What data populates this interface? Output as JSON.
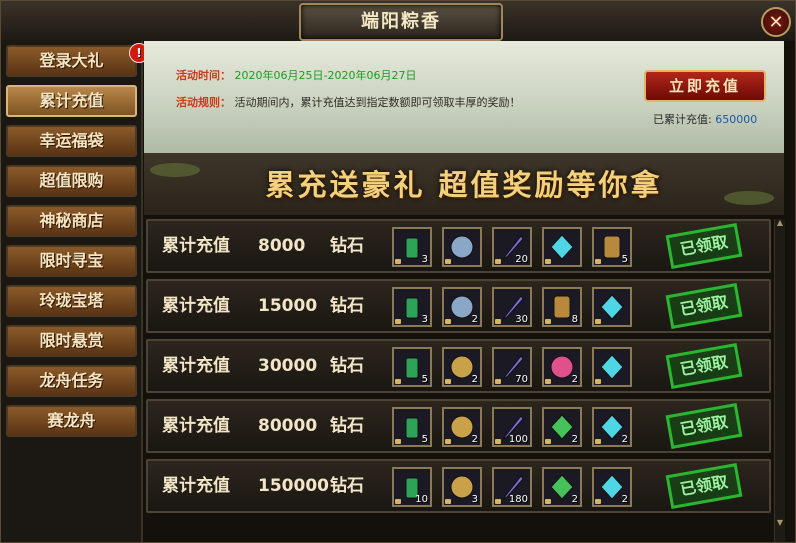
{
  "window": {
    "title": "端阳粽香",
    "close_glyph": "✕"
  },
  "sidebar": {
    "badge": "!",
    "items": [
      {
        "label": "登录大礼"
      },
      {
        "label": "累计充值"
      },
      {
        "label": "幸运福袋"
      },
      {
        "label": "超值限购"
      },
      {
        "label": "神秘商店"
      },
      {
        "label": "限时寻宝"
      },
      {
        "label": "玲珑宝塔"
      },
      {
        "label": "限时悬赏"
      },
      {
        "label": "龙舟任务"
      },
      {
        "label": "赛龙舟"
      }
    ],
    "active_index": 1
  },
  "info": {
    "time_label": "活动时间：",
    "time_value": "2020年06月25日-2020年06月27日",
    "rule_label": "活动规则：",
    "rule_value": "活动期间内，累计充值达到指定数额即可领取丰厚的奖励！",
    "recharge_button": "立即充值",
    "total_label": "已累计充值:",
    "total_value": "650000"
  },
  "banner": {
    "text": "累充送豪礼  超值奖励等你拿"
  },
  "tiers": [
    {
      "prefix": "累计充值",
      "amount": "8000",
      "unit": "钻石",
      "status": "已领取",
      "items": [
        {
          "icon": "jade-token-icon",
          "qty": "3",
          "color": "#2fa25a"
        },
        {
          "icon": "silver-coin-icon",
          "qty": "",
          "color": "#8aa7c8"
        },
        {
          "icon": "feather-icon",
          "qty": "20",
          "color": "#7b6bd8"
        },
        {
          "icon": "diamond-icon",
          "qty": "",
          "color": "#4fd6e6"
        },
        {
          "icon": "scroll-icon",
          "qty": "5",
          "color": "#b8893d"
        }
      ]
    },
    {
      "prefix": "累计充值",
      "amount": "15000",
      "unit": "钻石",
      "status": "已领取",
      "items": [
        {
          "icon": "jade-token-icon",
          "qty": "3",
          "color": "#2fa25a"
        },
        {
          "icon": "silver-coin-icon",
          "qty": "2",
          "color": "#8aa7c8"
        },
        {
          "icon": "feather-icon",
          "qty": "30",
          "color": "#7b6bd8"
        },
        {
          "icon": "scroll-icon",
          "qty": "8",
          "color": "#b8893d"
        },
        {
          "icon": "diamond-icon",
          "qty": "",
          "color": "#4fd6e6"
        }
      ]
    },
    {
      "prefix": "累计充值",
      "amount": "30000",
      "unit": "钻石",
      "status": "已领取",
      "items": [
        {
          "icon": "jade-token-icon",
          "qty": "5",
          "color": "#2fa25a"
        },
        {
          "icon": "gold-coin-icon",
          "qty": "2",
          "color": "#c8a14a"
        },
        {
          "icon": "feather-icon",
          "qty": "70",
          "color": "#7b6bd8"
        },
        {
          "icon": "rainbow-orb-icon",
          "qty": "2",
          "color": "#e0508a"
        },
        {
          "icon": "diamond-icon",
          "qty": "",
          "color": "#4fd6e6"
        }
      ]
    },
    {
      "prefix": "累计充值",
      "amount": "80000",
      "unit": "钻石",
      "status": "已领取",
      "items": [
        {
          "icon": "jade-token-icon",
          "qty": "5",
          "color": "#2fa25a"
        },
        {
          "icon": "gold-coin-icon",
          "qty": "2",
          "color": "#c8a14a"
        },
        {
          "icon": "feather-icon",
          "qty": "100",
          "color": "#7b6bd8"
        },
        {
          "icon": "green-crystal-icon",
          "qty": "2",
          "color": "#46c25a"
        },
        {
          "icon": "cyan-crystal-icon",
          "qty": "2",
          "color": "#4fd6e6"
        }
      ]
    },
    {
      "prefix": "累计充值",
      "amount": "150000",
      "unit": "钻石",
      "status": "已领取",
      "items": [
        {
          "icon": "jade-token-icon",
          "qty": "10",
          "color": "#2fa25a"
        },
        {
          "icon": "gold-coin-icon",
          "qty": "3",
          "color": "#c8a14a"
        },
        {
          "icon": "feather-icon",
          "qty": "180",
          "color": "#7b6bd8"
        },
        {
          "icon": "green-crystal-icon",
          "qty": "2",
          "color": "#46c25a"
        },
        {
          "icon": "cyan-crystal-icon",
          "qty": "2",
          "color": "#4fd6e6"
        }
      ]
    }
  ]
}
